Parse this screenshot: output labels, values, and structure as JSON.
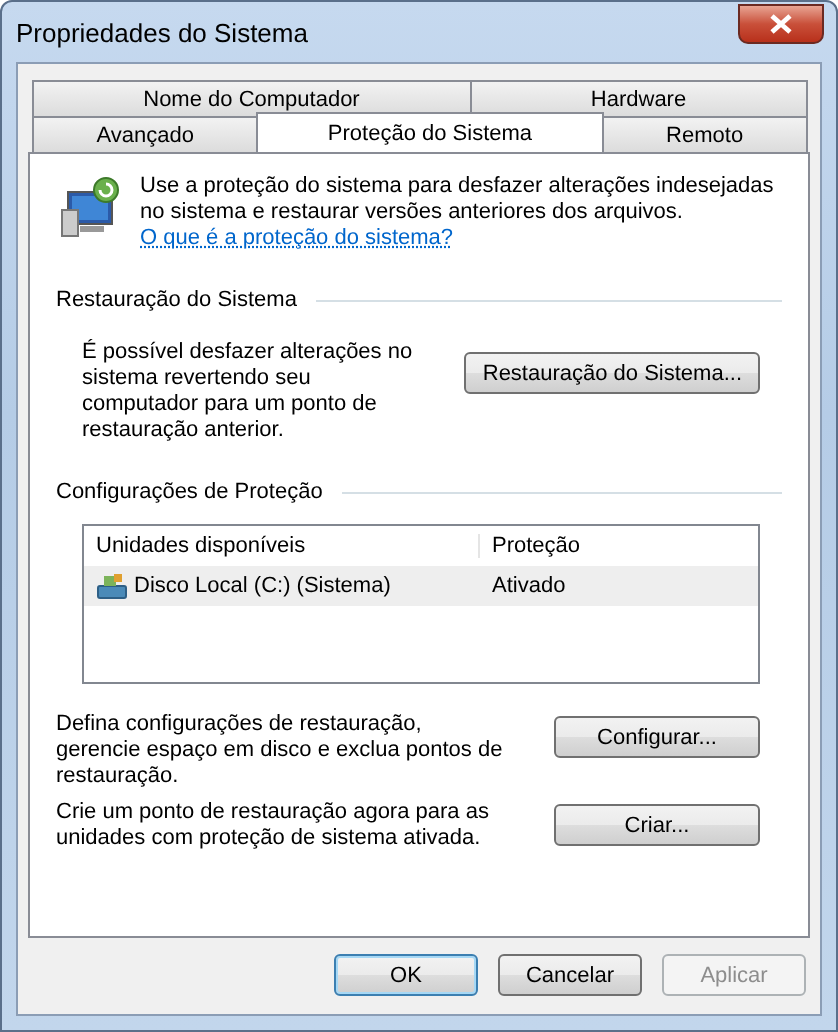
{
  "window": {
    "title": "Propriedades do Sistema"
  },
  "tab_rows": [
    [
      {
        "label": "Nome do Computador",
        "selected": false
      },
      {
        "label": "Hardware",
        "selected": false
      }
    ],
    [
      {
        "label": "Avançado",
        "selected": false
      },
      {
        "label": "Proteção do Sistema",
        "selected": true
      },
      {
        "label": "Remoto",
        "selected": false
      }
    ]
  ],
  "intro": {
    "text": "Use a proteção do sistema para desfazer alterações indesejadas no sistema e restaurar versões anteriores dos arquivos.",
    "link": "O que é a proteção do sistema?"
  },
  "restore_section": {
    "heading": "Restauração do Sistema",
    "text": "É possível desfazer alterações no sistema revertendo seu computador para um ponto de restauração anterior.",
    "button": "Restauração do Sistema..."
  },
  "protection_section": {
    "heading": "Configurações de Proteção",
    "table": {
      "columns": [
        "Unidades disponíveis",
        "Proteção"
      ],
      "rows": [
        {
          "drive": "Disco Local (C:) (Sistema)",
          "protection": "Ativado",
          "selected": true
        }
      ]
    },
    "actions": [
      {
        "text": "Defina configurações de restauração, gerencie espaço em disco e exclua pontos de restauração.",
        "button": "Configurar..."
      },
      {
        "text": "Crie um ponto de restauração agora para as unidades com proteção de sistema ativada.",
        "button": "Criar..."
      }
    ]
  },
  "footer_buttons": [
    {
      "label": "OK",
      "disabled": false
    },
    {
      "label": "Cancelar",
      "disabled": false
    },
    {
      "label": "Aplicar",
      "disabled": true
    }
  ]
}
